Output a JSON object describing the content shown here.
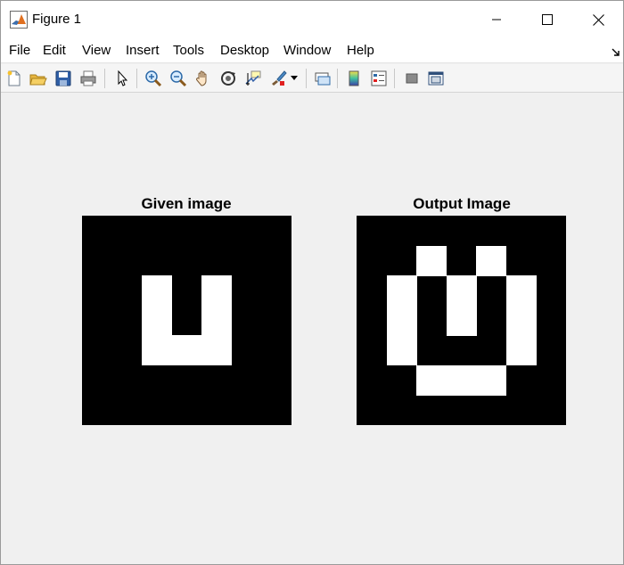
{
  "window": {
    "title": "Figure 1"
  },
  "menu": {
    "items": [
      "File",
      "Edit",
      "View",
      "Insert",
      "Tools",
      "Desktop",
      "Window",
      "Help"
    ]
  },
  "toolbar": {
    "icons": [
      "new-figure-icon",
      "open-file-icon",
      "save-icon",
      "print-icon",
      "select-arrow-icon",
      "zoom-in-icon",
      "zoom-out-icon",
      "pan-hand-icon",
      "rotate-3d-icon",
      "data-cursor-icon",
      "brush-icon",
      "brush-dropdown-icon",
      "link-plot-icon",
      "insert-colorbar-icon",
      "insert-legend-icon",
      "hide-plot-tools-icon",
      "show-plot-tools-icon"
    ]
  },
  "plots": [
    {
      "title": "Given image",
      "grid_size": 7,
      "white_pixels": [
        [
          2,
          2
        ],
        [
          2,
          4
        ],
        [
          3,
          2
        ],
        [
          3,
          4
        ],
        [
          4,
          2
        ],
        [
          4,
          3
        ],
        [
          4,
          4
        ]
      ]
    },
    {
      "title": "Output Image",
      "grid_size": 7,
      "white_pixels": [
        [
          1,
          2
        ],
        [
          1,
          4
        ],
        [
          2,
          1
        ],
        [
          2,
          3
        ],
        [
          2,
          5
        ],
        [
          3,
          1
        ],
        [
          3,
          3
        ],
        [
          3,
          5
        ],
        [
          4,
          1
        ],
        [
          4,
          5
        ],
        [
          5,
          2
        ],
        [
          5,
          3
        ],
        [
          5,
          4
        ]
      ]
    }
  ],
  "colors": {
    "background": "#f0f0f0",
    "image_black": "#000000",
    "image_white": "#ffffff"
  }
}
